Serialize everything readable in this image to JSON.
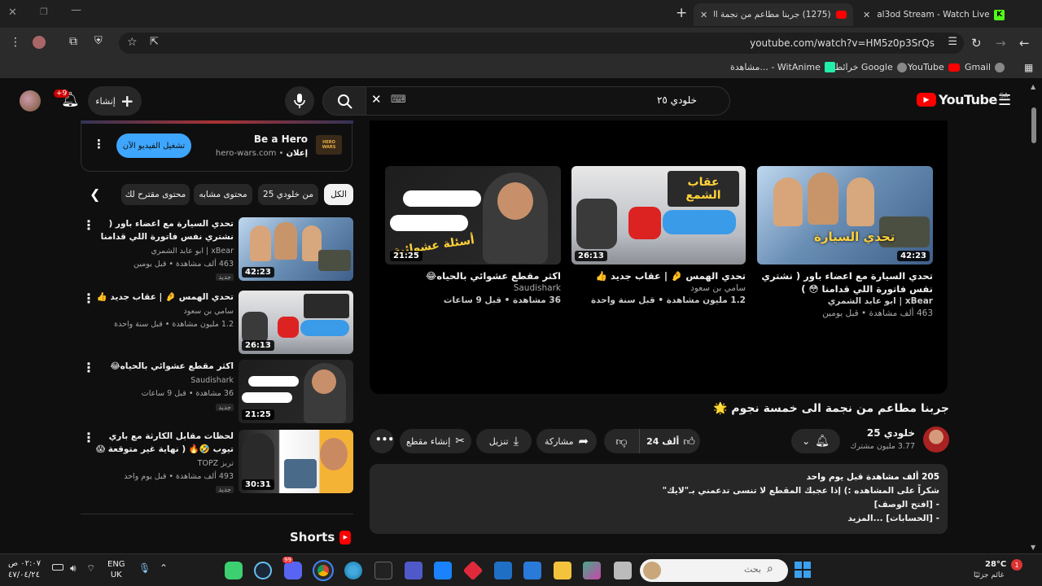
{
  "browser": {
    "tabs": [
      {
        "title": "al3od Stream - Watch Live on K",
        "active": false
      },
      {
        "title": "(1275) جربنا مطاعم من نجمة الـ",
        "active": true
      }
    ],
    "new_tab": "+",
    "url": "youtube.com/watch?v=HM5z0p3SrQs",
    "bookmarks": [
      "Gmail",
      "YouTube",
      "خرائط Google",
      "مشاهدة... - WitAnime"
    ]
  },
  "yt_header": {
    "logo_text": "YouTube",
    "region": "SA",
    "search_value": "خلودي ٢٥",
    "create_label": "إنشاء",
    "notif_count": "+9"
  },
  "end_cards": [
    {
      "title": "تحدي السيارة مع اعضاء باور ( نشتري نفس فاتورة اللي قدامنا 😳 )",
      "channel": "xBear | ابو عابد الشمري",
      "meta": "463 ألف مشاهدة • قبل يومين",
      "duration": "42:23",
      "overlay": "تحدي السيارة"
    },
    {
      "title": "تحدي الهمس 🤌 | عقاب جديد 👍",
      "channel": "سامي بن سعود",
      "meta": "1.2 مليون مشاهدة • قبل سنة واحدة",
      "duration": "26:13",
      "overlay": "عقاب الشمع"
    },
    {
      "title": "اكثر مقطع عشوائي بالحياه😂",
      "channel": "Saudishark",
      "meta": "36 مشاهدة • قبل 9 ساعات",
      "duration": "21:25",
      "overlay": "أسئلة عشوائية"
    }
  ],
  "video": {
    "title": "جربنا مطاعم من نجمة الى خمسة نجوم 🌟",
    "channel": "خلودي 25",
    "subscribers": "3.77 مليون مشترك",
    "likes": "24 ألف",
    "share": "مشاركة",
    "download": "تنزيل",
    "clip": "إنشاء مقطع",
    "desc_stats": "205 ألف مشاهدة  قبل يوم واحد",
    "desc_lines": [
      "شكراً على المشاهده :) إذا عجبك المقطع لا تنسى تدعمني بـ\"لايك\"",
      "-  [افتح الوصف]",
      "-  [الحسابات]  ...المزيد"
    ]
  },
  "ad": {
    "title": "Be a Hero",
    "label": "إعلان",
    "domain": "hero-wars.com",
    "cta": "تشغيل الفيديو الآن",
    "brand": "HERO WARS"
  },
  "chips": [
    "الكل",
    "من خلودي 25",
    "محتوى مشابه",
    "محتوى مقترح لك"
  ],
  "sidebar": [
    {
      "title": "تحدي السيارة مع اعضاء باور ( نشتري نفس فاتورة اللي قدامنا 😳 )",
      "channel": "xBear | ابو عابد الشمري",
      "meta": "463 ألف مشاهدة • قبل يومين",
      "badge": "جديد",
      "duration": "42:23"
    },
    {
      "title": "تحدي الهمس 🤌 | عقاب جديد 👍",
      "channel": "سامي بن سعود",
      "meta": "1.2 مليون مشاهدة • قبل سنة واحدة",
      "badge": "",
      "duration": "26:13"
    },
    {
      "title": "اكثر مقطع عشوائي بالحياه😂",
      "channel": "Saudishark",
      "meta": "36 مشاهدة • قبل 9 ساعات",
      "badge": "جديد",
      "duration": "21:25"
    },
    {
      "title": "لحظات مقابل الكارثة مع باري تيوب 🤣🔥 ( نهاية غير متوقعة 😱 )",
      "channel": "تربز TOPZ",
      "meta": "493 ألف مشاهدة • قبل يوم واحد",
      "badge": "جديد",
      "duration": "30:31"
    }
  ],
  "shorts_label": "Shorts",
  "taskbar": {
    "weather_temp": "28°C",
    "weather_desc": "غائم جزئيًا",
    "weather_badge": "1",
    "search_placeholder": "بحث",
    "lang_1": "ENG",
    "lang_2": "UK",
    "time": "٠٢:٠٧ ص",
    "date": "٤٧/٠٤/٢٤",
    "discord_badge": "99"
  }
}
